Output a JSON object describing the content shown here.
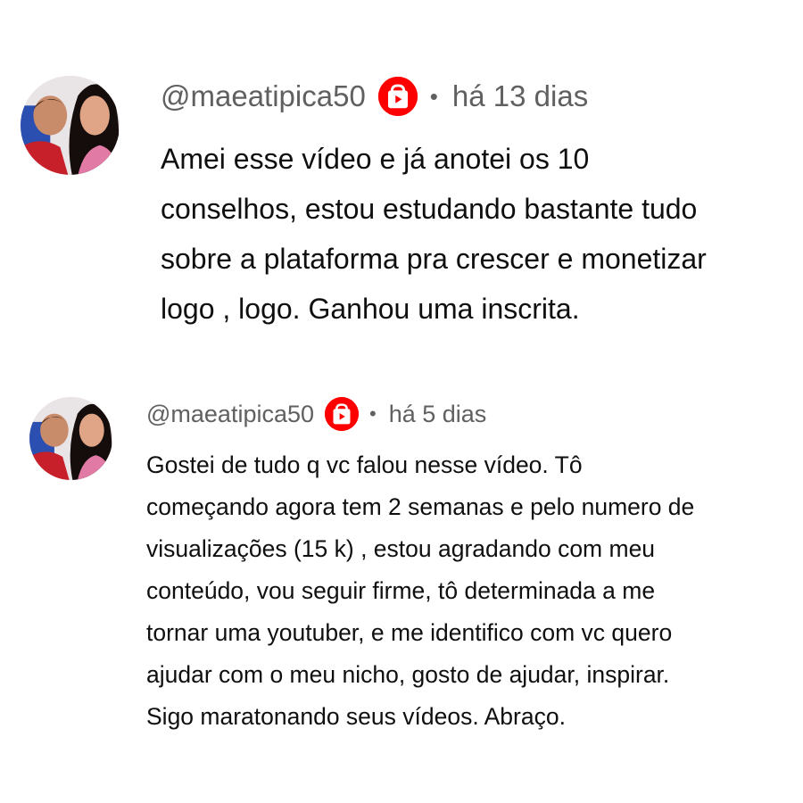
{
  "comments": [
    {
      "handle": "@maeatipica50",
      "separator": "•",
      "time": "há 13 dias",
      "badge_icon": "youtube-shopping-bag-icon",
      "avatar_icon": "profile-photo-couple",
      "lines": [
        "Amei esse vídeo e já anotei os 10",
        "conselhos, estou estudando bastante tudo",
        "sobre a plataforma pra crescer e monetizar",
        "logo , logo. Ganhou uma inscrita."
      ]
    },
    {
      "handle": "@maeatipica50",
      "separator": "•",
      "time": "há 5 dias",
      "badge_icon": "youtube-shopping-bag-icon",
      "avatar_icon": "profile-photo-couple",
      "lines": [
        "Gostei de tudo q vc falou nesse vídeo. Tô",
        "começando agora tem 2 semanas e pelo numero de",
        "visualizações (15 k) , estou agradando com meu",
        "conteúdo, vou seguir firme, tô determinada a me",
        "tornar uma youtuber, e me identifico com vc quero",
        "ajudar com o meu nicho, gosto de ajudar, inspirar.",
        "Sigo maratonando seus vídeos. Abraço."
      ]
    }
  ],
  "colors": {
    "badge": "#ff0000",
    "meta_text": "#606060",
    "body_text": "#0f0f0f",
    "background": "#ffffff"
  }
}
